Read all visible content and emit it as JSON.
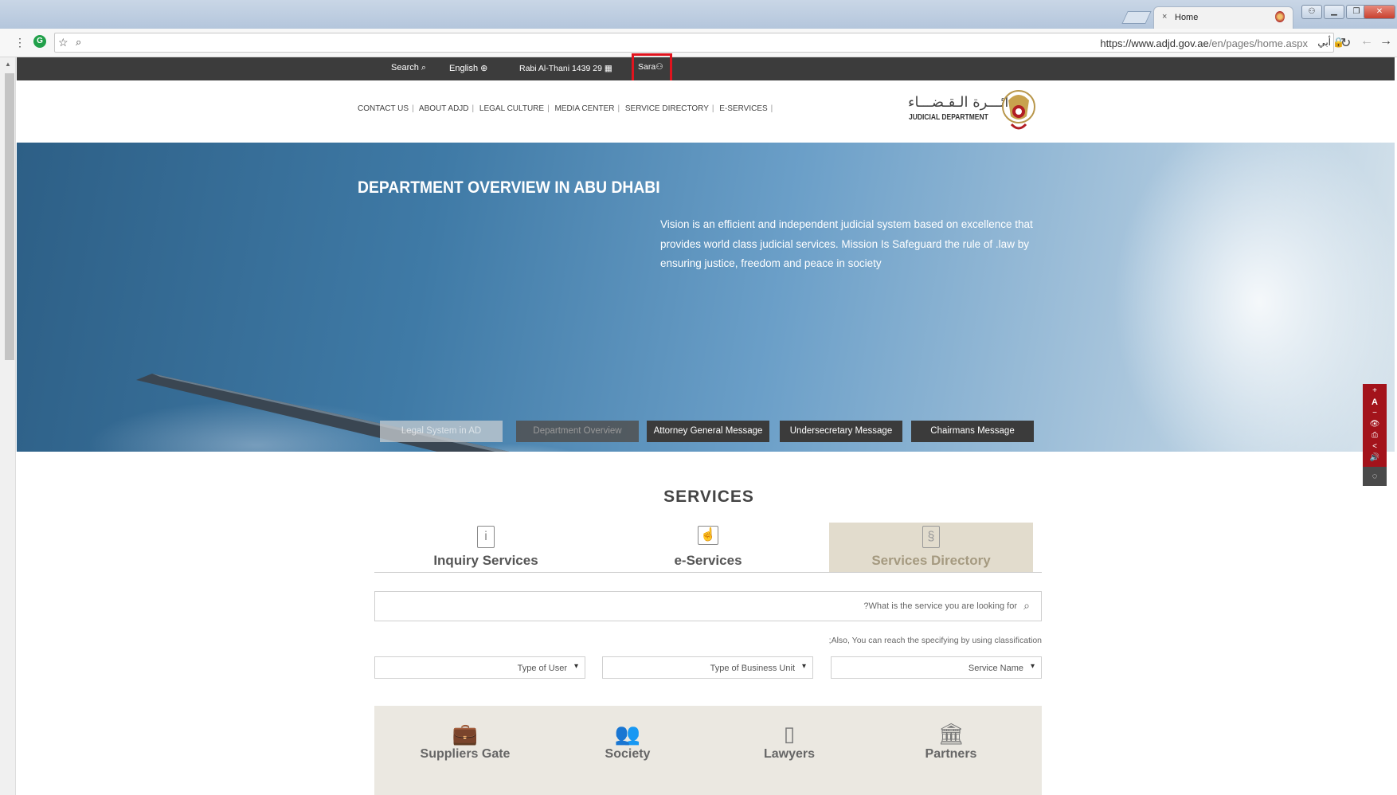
{
  "browser": {
    "tab_title": "Home",
    "tab_close": "×",
    "url_host": "https://www.adjd.gov.ae",
    "url_path": "/en/pages/home.aspx",
    "url_badge": "أبي"
  },
  "topbar": {
    "search": "Search",
    "language": "English",
    "date": "Rabi Al-Thani  1439  29",
    "user": "Sara"
  },
  "nav": {
    "items": [
      "CONTACT US",
      "ABOUT ADJD",
      "LEGAL CULTURE",
      "MEDIA CENTER",
      "SERVICE DIRECTORY",
      "E-SERVICES"
    ]
  },
  "logo": {
    "arabic": "دائـــرة الـقـضـــاء",
    "english": "JUDICIAL DEPARTMENT"
  },
  "hero": {
    "title": "DEPARTMENT OVERVIEW IN ABU DHABI",
    "text": "Vision is an efficient and independent judicial system based on excellence that provides world class judicial services. Mission Is Safeguard the rule of .law by ensuring justice, freedom and peace in society",
    "tabs": [
      "Legal System in AD",
      "Department Overview",
      "Attorney General Message",
      "Undersecretary Message",
      "Chairmans Message"
    ]
  },
  "side_tools": [
    "+",
    "A",
    "−",
    "👁",
    "⎙",
    "<",
    "🔊"
  ],
  "services": {
    "title": "SERVICES",
    "tabs": [
      "Inquiry Services",
      "e-Services",
      "Services Directory"
    ],
    "search_placeholder": "?What is the service you are looking for",
    "also_text": ";Also, You can reach the specifying by using classification",
    "filters": [
      "Type of User",
      "Type of Business Unit",
      "Service Name"
    ]
  },
  "quick_links": [
    "Suppliers Gate",
    "Society",
    "Lawyers",
    "Partners"
  ],
  "colors": {
    "topbar_bg": "#3c3c3c",
    "accent_red": "#a3131b",
    "highlight": "#e0141e",
    "active_tab_bg": "#e2dccd"
  }
}
